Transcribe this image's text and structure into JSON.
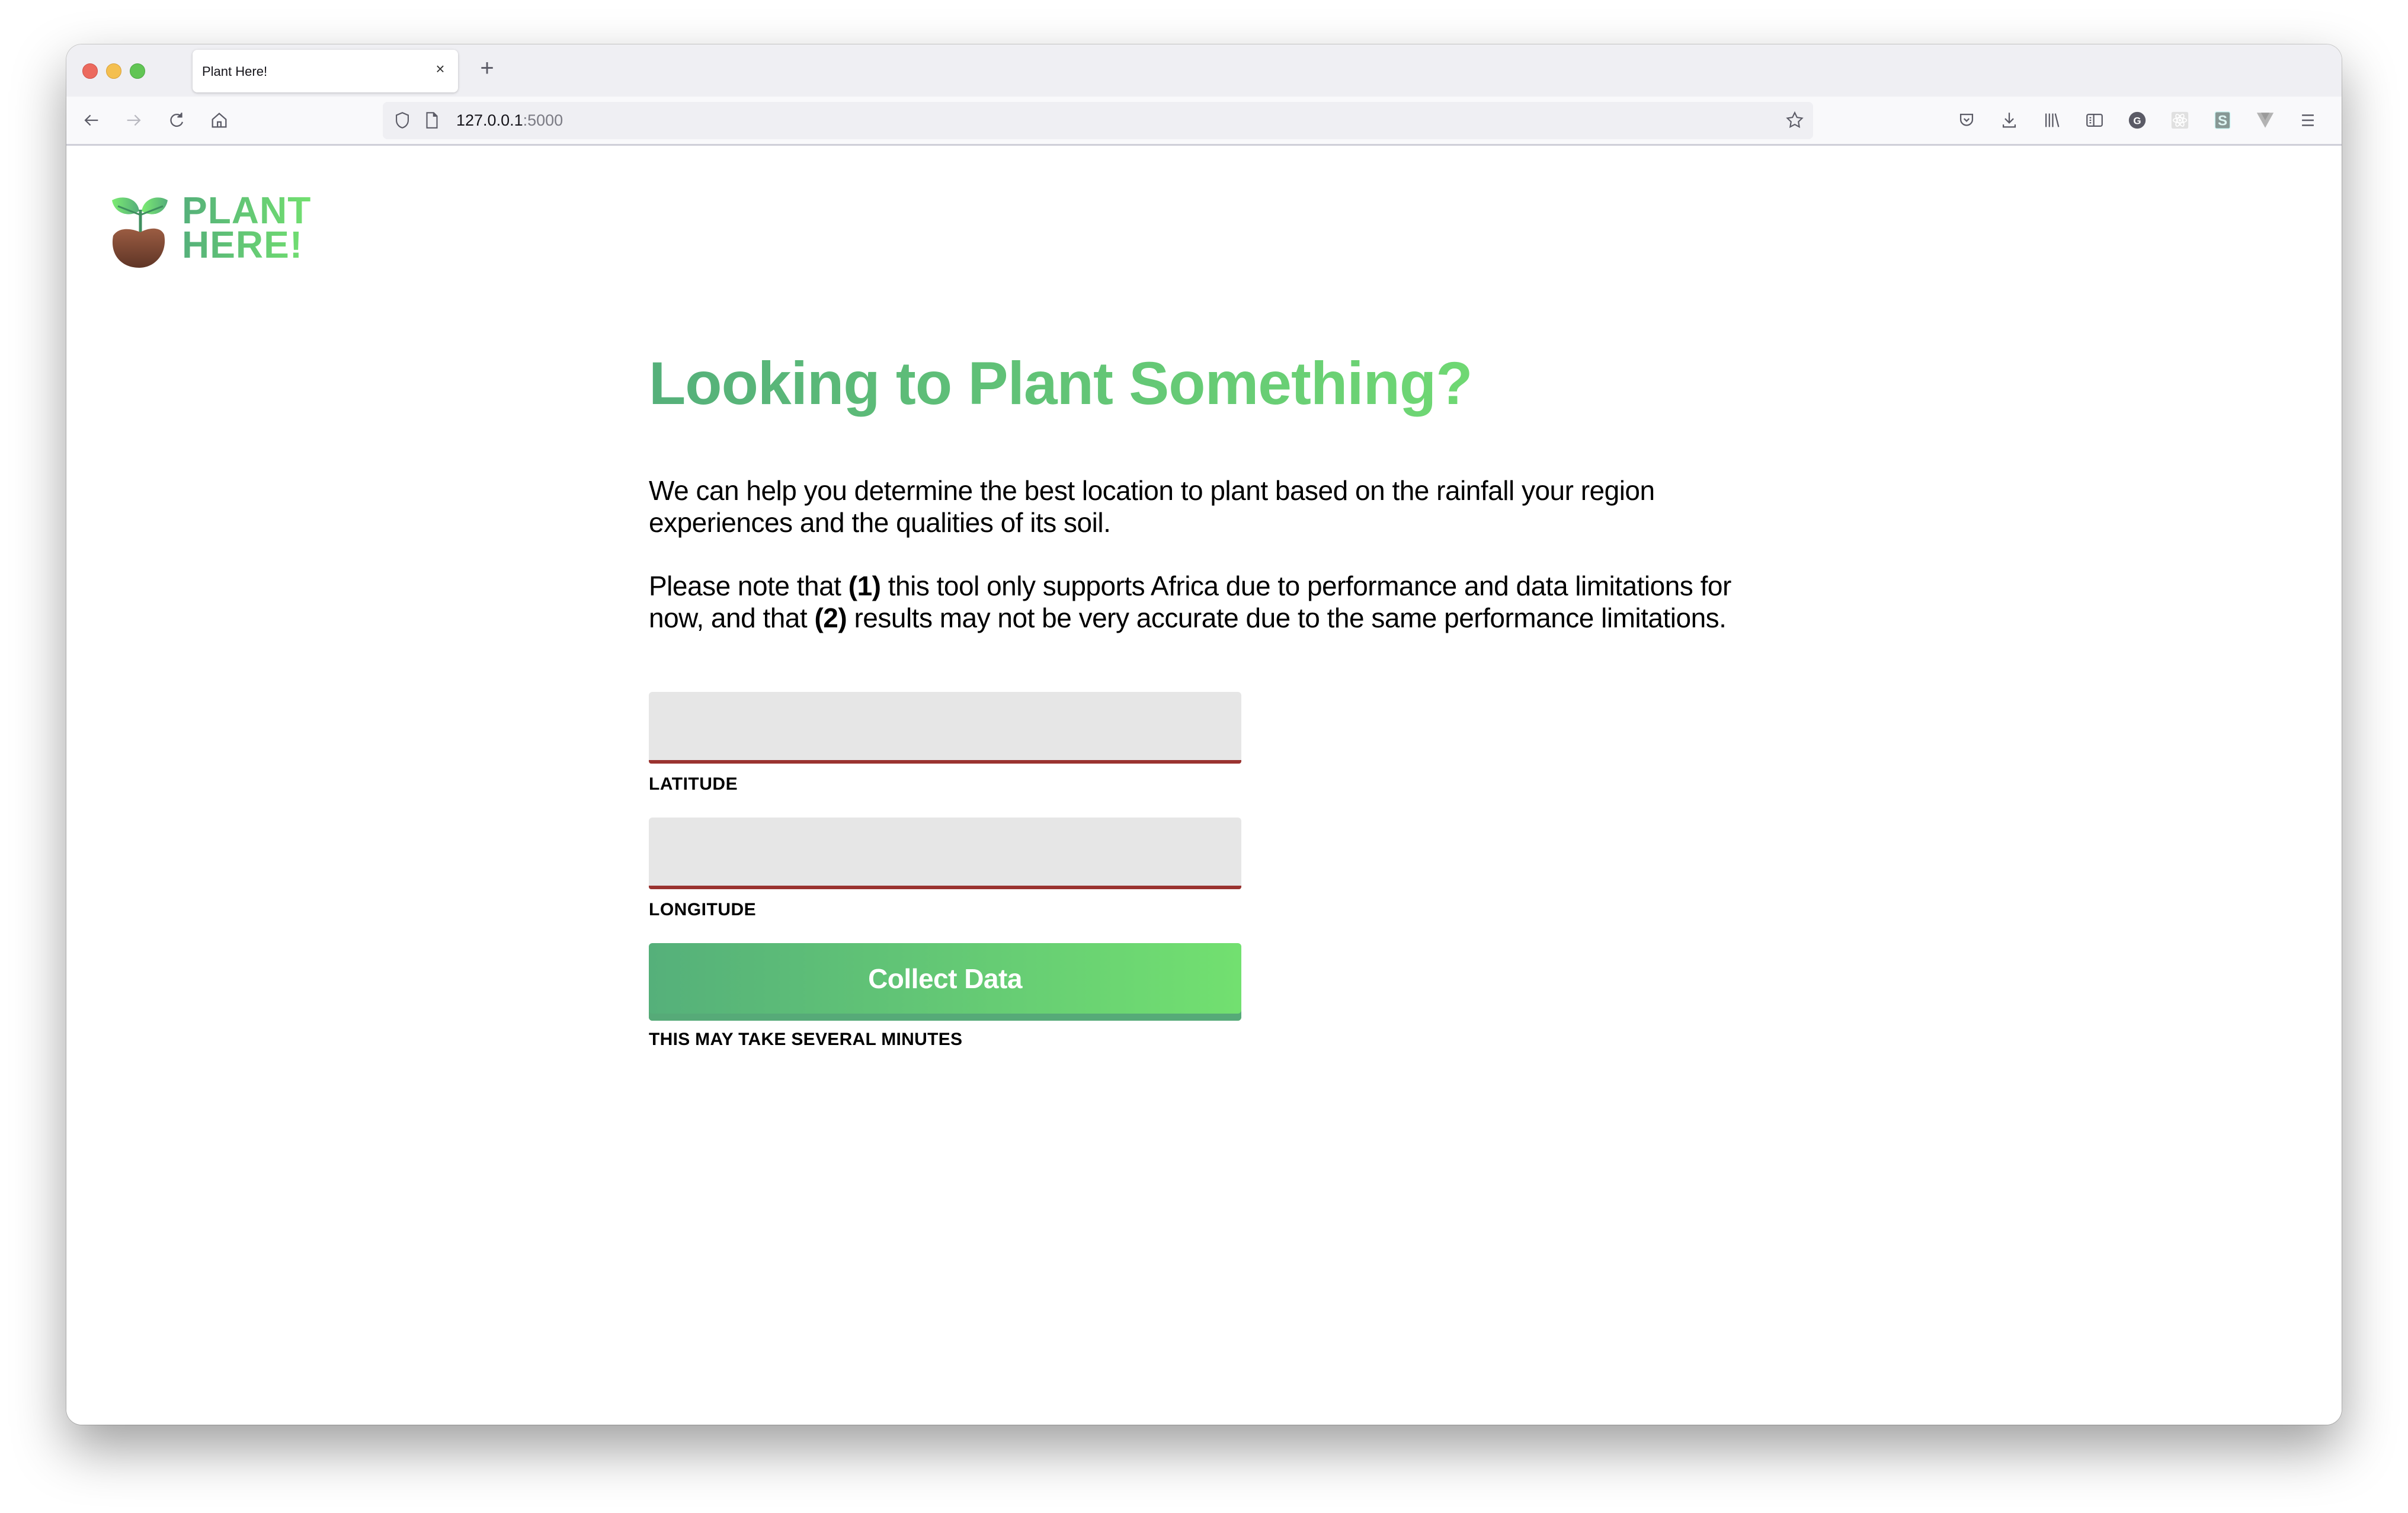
{
  "browser": {
    "tab": {
      "title": "Plant Here!",
      "close_label": "×"
    },
    "new_tab_label": "+",
    "url": {
      "host": "127.0.0.1",
      "port": ":5000"
    },
    "nav_icons": [
      "back-arrow-icon",
      "forward-arrow-icon",
      "reload-icon",
      "home-icon"
    ],
    "url_icons": [
      "shield-icon",
      "page-icon",
      "bookmark-star-icon"
    ],
    "toolbar_icons": [
      "pocket-icon",
      "download-icon",
      "library-icon",
      "sidebar-icon",
      "grammarly-extension-icon",
      "react-devtools-icon",
      "stylus-extension-icon",
      "vue-devtools-icon",
      "menu-icon"
    ]
  },
  "logo": {
    "line1": "PLANT",
    "line2": "HERE!"
  },
  "main": {
    "heading": "Looking to Plant Something?",
    "intro": "We can help you determine the best location to plant based on the rainfall your region experiences and the qualities of its soil.",
    "note": {
      "part1": "Please note that ",
      "marker1": "(1)",
      "part2": " this tool only supports Africa due to performance and data limitations for now, and that ",
      "marker2": "(2)",
      "part3": " results may not be very accurate due to the same performance limitations."
    },
    "latitude": {
      "label": "LATITUDE",
      "value": "",
      "placeholder": ""
    },
    "longitude": {
      "label": "LONGITUDE",
      "value": "",
      "placeholder": ""
    },
    "collect_button": "Collect Data",
    "wait_note": "THIS MAY TAKE SEVERAL MINUTES"
  },
  "colors": {
    "brand_green_start": "#55b07a",
    "brand_green_end": "#72e070",
    "input_underline": "#9a3330",
    "input_bg": "#e6e6e6"
  }
}
